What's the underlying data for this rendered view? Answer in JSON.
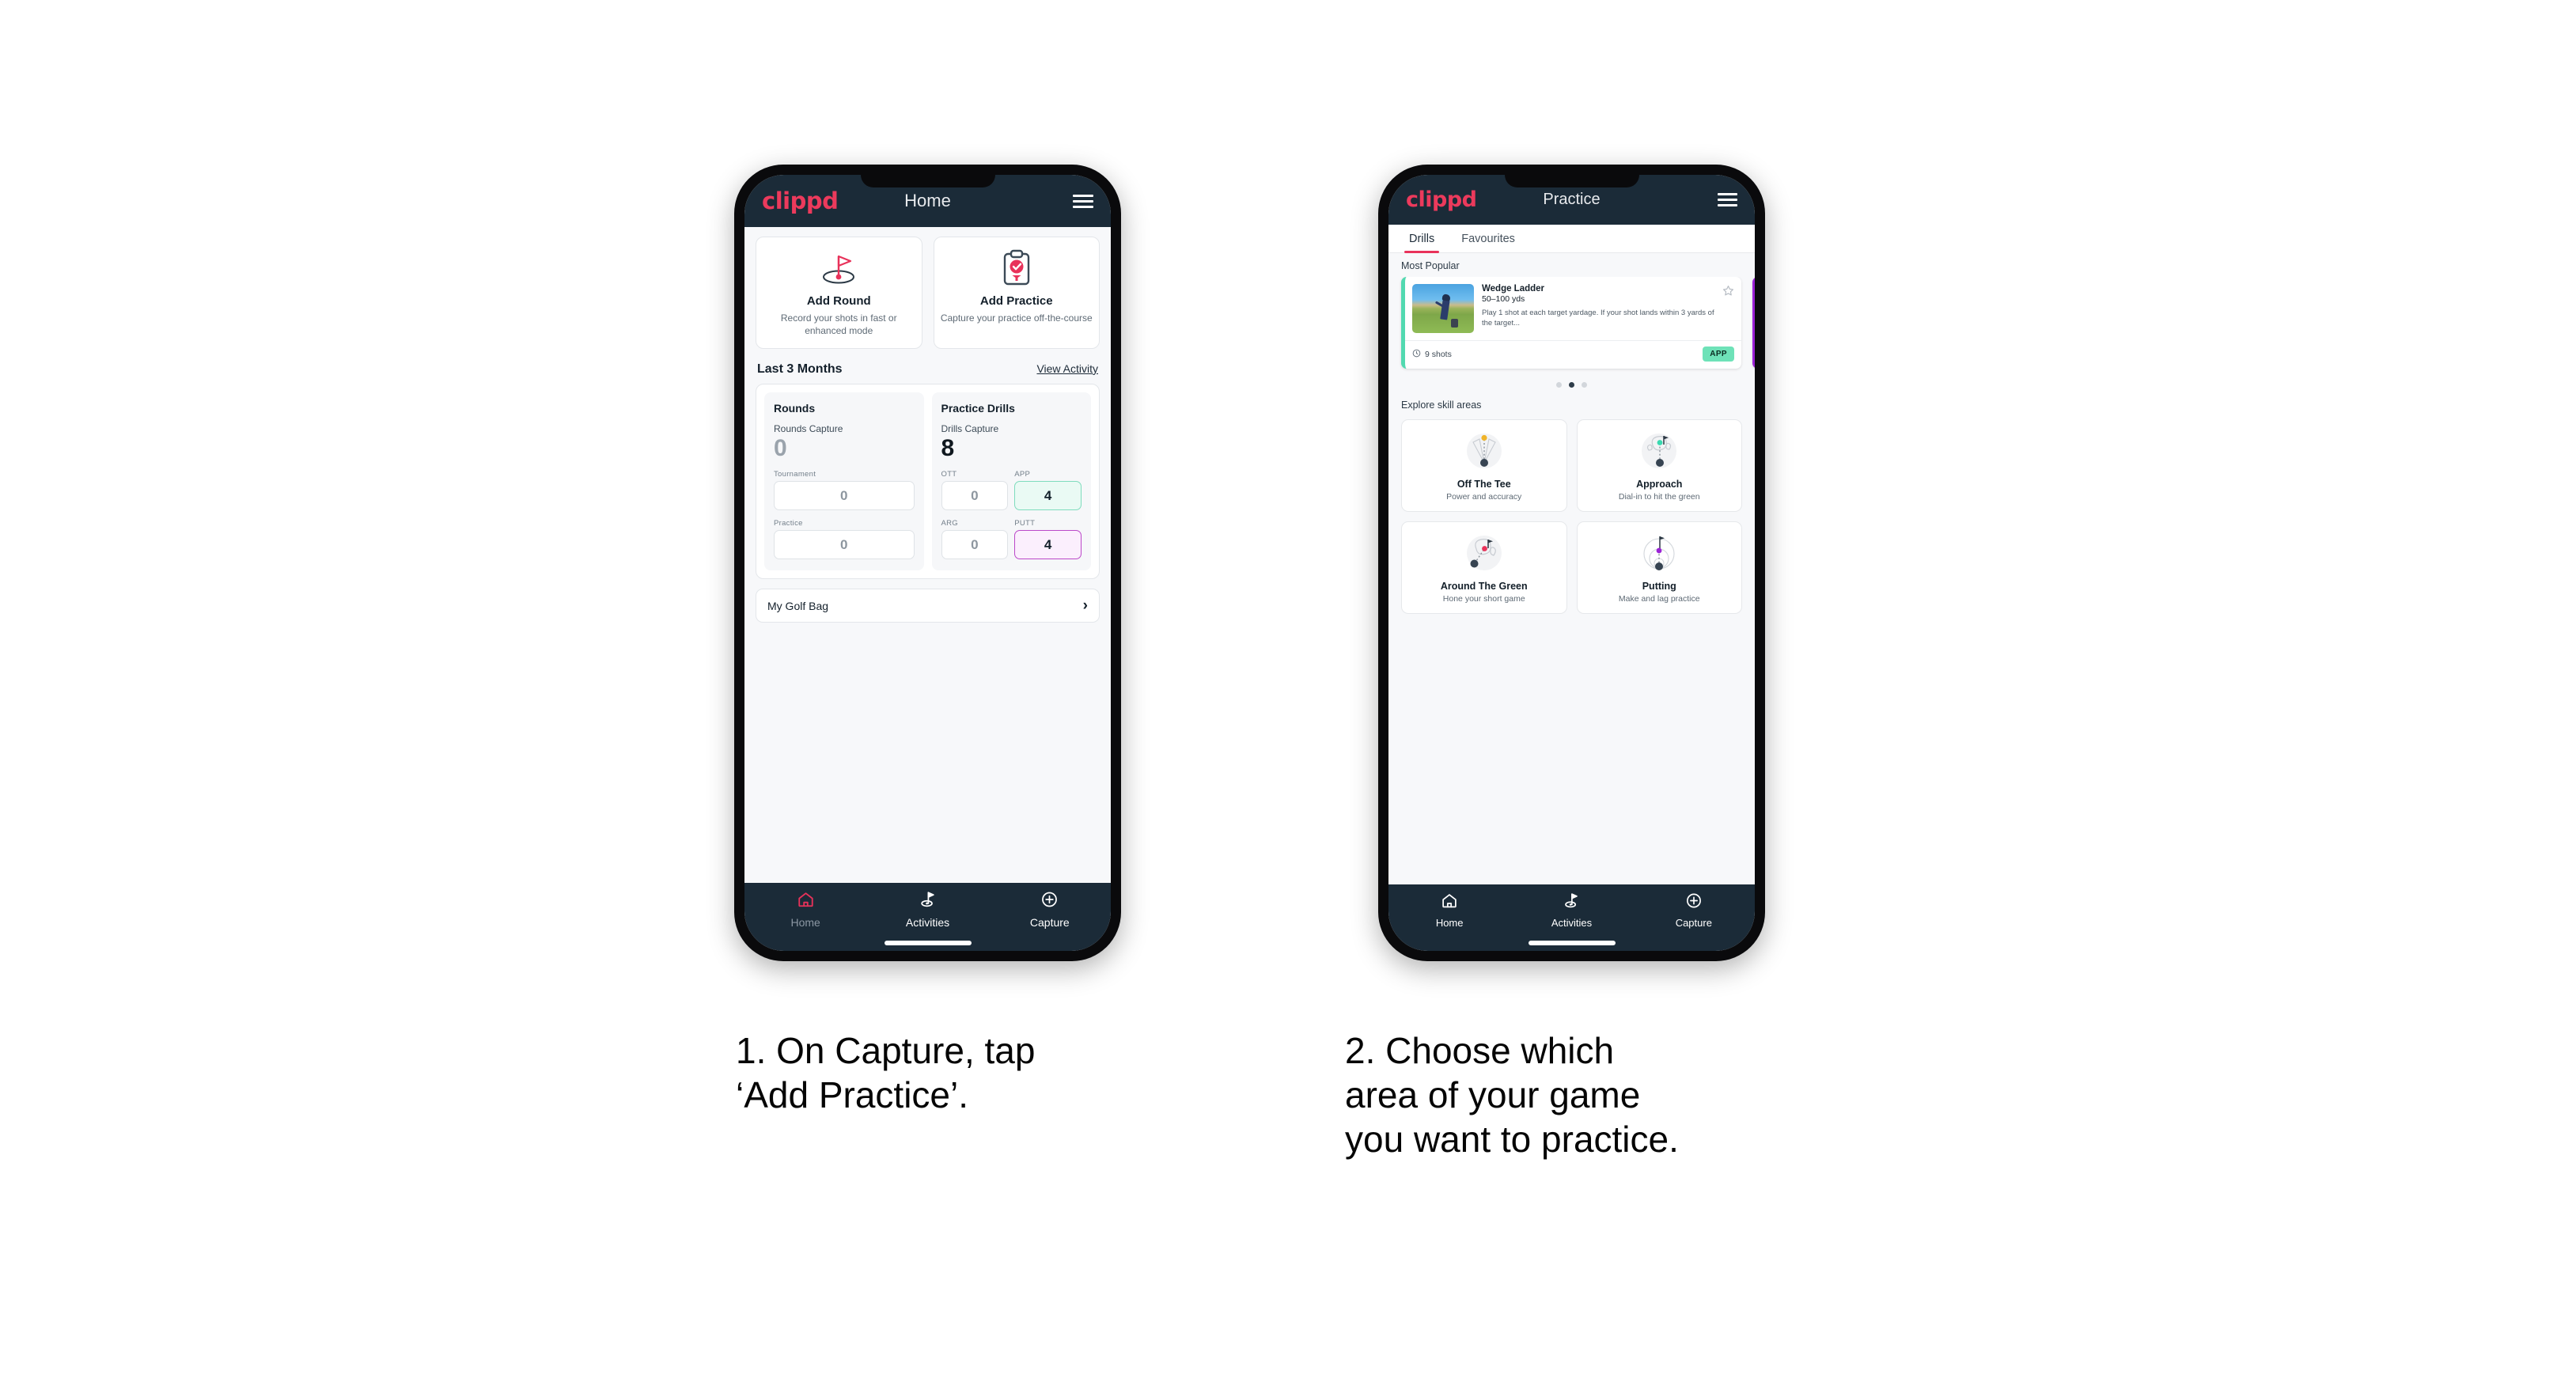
{
  "brand": "clippd",
  "phone_home": {
    "header": {
      "title": "Home",
      "menu_icon": "hamburger-icon"
    },
    "actions": [
      {
        "icon": "golf-flag-hole-icon",
        "title": "Add Round",
        "subtitle": "Record your shots in fast or enhanced mode"
      },
      {
        "icon": "clipboard-check-tee-icon",
        "title": "Add Practice",
        "subtitle": "Capture your practice off-the-course"
      }
    ],
    "section": {
      "title": "Last 3 Months",
      "link": "View Activity"
    },
    "stats": {
      "rounds": {
        "heading": "Rounds",
        "caption": "Rounds Capture",
        "total": "0",
        "items": [
          {
            "label": "Tournament",
            "value": "0"
          },
          {
            "label": "Practice",
            "value": "0"
          }
        ]
      },
      "drills": {
        "heading": "Practice Drills",
        "caption": "Drills Capture",
        "total": "8",
        "items": [
          {
            "label": "OTT",
            "value": "0"
          },
          {
            "label": "APP",
            "value": "4"
          },
          {
            "label": "ARG",
            "value": "0"
          },
          {
            "label": "PUTT",
            "value": "4"
          }
        ]
      }
    },
    "golf_bag": {
      "label": "My Golf Bag",
      "chevron": "chevron-right-icon"
    },
    "nav": [
      {
        "label": "Home",
        "icon": "home-icon",
        "active": true
      },
      {
        "label": "Activities",
        "icon": "golf-flag-icon",
        "active": false
      },
      {
        "label": "Capture",
        "icon": "plus-circle-icon",
        "active": false
      }
    ]
  },
  "phone_practice": {
    "header": {
      "title": "Practice",
      "menu_icon": "hamburger-icon"
    },
    "tabs": [
      {
        "label": "Drills",
        "active": true
      },
      {
        "label": "Favourites",
        "active": false
      }
    ],
    "most_popular_label": "Most Popular",
    "drill": {
      "title": "Wedge Ladder",
      "yardage": "50–100 yds",
      "description": "Play 1 shot at each target yardage. If your shot lands within 3 yards of the target...",
      "shots": "9 shots",
      "shots_icon": "clock-icon",
      "badge": "APP",
      "star_icon": "star-outline-icon",
      "accent": "#52d9b0",
      "next_accent": "#9b22d6",
      "thumbnail": "golfer-chipping-photo"
    },
    "carousel_dots": {
      "count": 3,
      "active_index": 1
    },
    "explore_label": "Explore skill areas",
    "skills": [
      {
        "name": "Off The Tee",
        "subtitle": "Power and accuracy",
        "illo": "tee-dispersion-icon",
        "dot_color": "#f0b429"
      },
      {
        "name": "Approach",
        "subtitle": "Dial-in to hit the green",
        "illo": "green-approach-icon",
        "dot_color": "#38d9b0"
      },
      {
        "name": "Around The Green",
        "subtitle": "Hone your short game",
        "illo": "chip-to-green-icon",
        "dot_color": "#e8325a"
      },
      {
        "name": "Putting",
        "subtitle": "Make and lag practice",
        "illo": "putting-rings-icon",
        "dot_color": "#9b22d6"
      }
    ],
    "nav": [
      {
        "label": "Home",
        "icon": "home-icon",
        "active": false
      },
      {
        "label": "Activities",
        "icon": "golf-flag-icon",
        "active": false
      },
      {
        "label": "Capture",
        "icon": "plus-circle-icon",
        "active": false
      }
    ]
  },
  "captions": {
    "step1": "1. On Capture, tap\n‘Add Practice’.",
    "step2": "2. Choose which\narea of your game\nyou want to practice."
  },
  "colors": {
    "brand_pink": "#ec3a5c",
    "header_navy": "#1b2b38",
    "app_bg": "#f7f8fa",
    "accent_green": "#52d9b0",
    "accent_purple": "#9b22d6"
  }
}
